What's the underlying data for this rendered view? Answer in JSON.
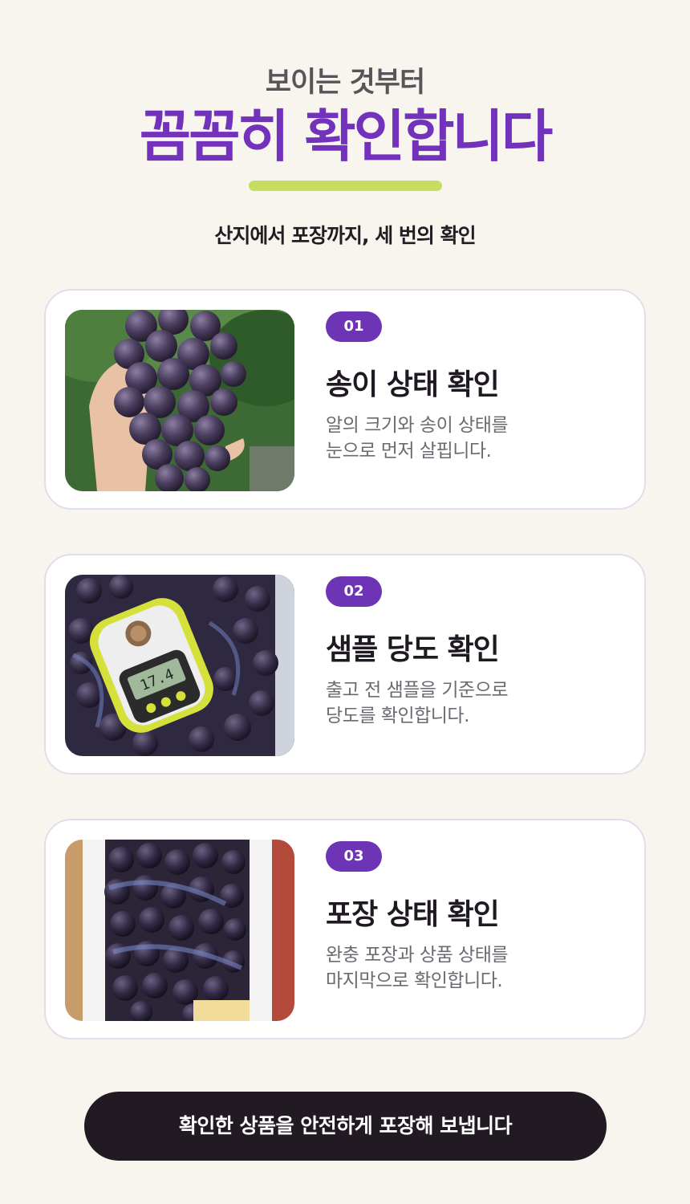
{
  "header": {
    "subtitle": "보이는 것부터",
    "headline": "꼼꼼히 확인합니다",
    "lead": "산지에서 포장까지, 세 번의 확인"
  },
  "cards": [
    {
      "badge": "01",
      "title": "송이 상태 확인",
      "desc_lines": [
        "알의 크기와 송이 상태를",
        "눈으로 먼저 살핍니다."
      ]
    },
    {
      "badge": "02",
      "title": "샘플 당도 확인",
      "desc_lines": [
        "출고 전 샘플을 기준으로",
        "당도를 확인합니다."
      ],
      "meter_reading": "17.4"
    },
    {
      "badge": "03",
      "title": "포장 상태 확인",
      "desc_lines": [
        "완충 포장과 상품 상태를",
        "마지막으로 확인합니다."
      ]
    }
  ],
  "cta": {
    "label": "확인한 상품을 안전하게 포장해 보냅니다"
  },
  "colors": {
    "background": "#f8f5ef",
    "accent_purple": "#7232bc",
    "badge_purple": "#6d35b6",
    "underline_green": "#c7dd62",
    "cta_dark": "#221a23",
    "card_border": "#e4dcec"
  }
}
